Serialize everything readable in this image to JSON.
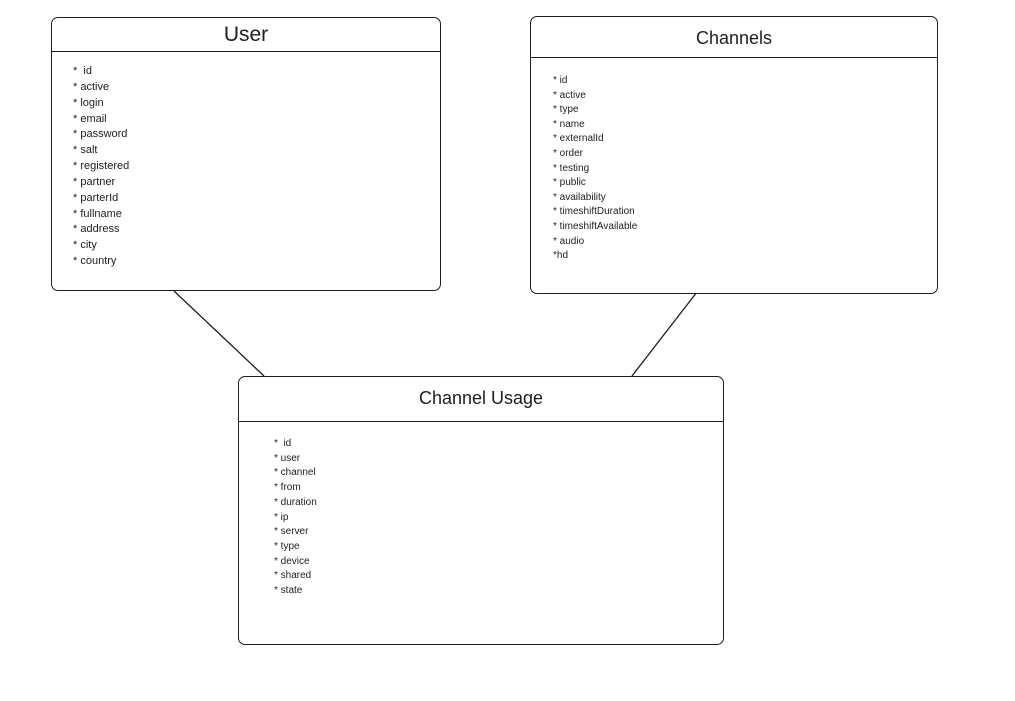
{
  "entities": {
    "user": {
      "title": "User",
      "fields": [
        "*  id",
        "* active",
        "* login",
        "* email",
        "* password",
        "* salt",
        "* registered",
        "* partner",
        "* parterId",
        "* fullname",
        "* address",
        "* city",
        "* country"
      ]
    },
    "channels": {
      "title": "Channels",
      "fields": [
        "* id",
        "* active",
        "* type",
        "* name",
        "* externalId",
        "* order",
        "* testing",
        "* public",
        "* availability",
        "* timeshiftDuration",
        "* timeshiftAvailable",
        "* audio",
        "*hd"
      ]
    },
    "channel_usage": {
      "title": "Channel Usage",
      "fields": [
        "*  id",
        "* user",
        "* channel",
        "* from",
        "* duration",
        "* ip",
        "* server",
        "* type",
        "* device",
        "* shared",
        "* state"
      ]
    }
  },
  "relationships": [
    {
      "from": "User",
      "to": "Channel Usage"
    },
    {
      "from": "Channels",
      "to": "Channel Usage"
    }
  ],
  "colors": {
    "stroke": "#1e1e1e",
    "background": "#ffffff"
  }
}
